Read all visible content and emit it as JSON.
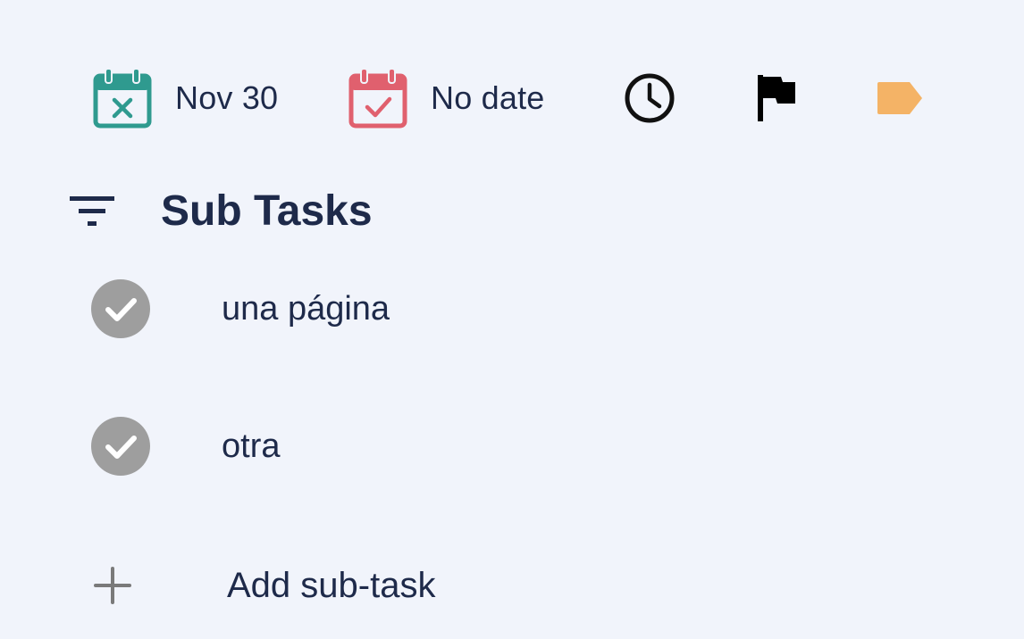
{
  "toolbar": {
    "start_date_label": "Nov 30",
    "due_date_label": "No date",
    "colors": {
      "start_calendar": "#2f9a8f",
      "due_calendar": "#e0606e",
      "clock": "#111111",
      "flag": "#000000",
      "tag": "#f4b366"
    },
    "icons": [
      "calendar-x-icon",
      "calendar-check-icon",
      "clock-icon",
      "flag-icon",
      "tag-icon"
    ]
  },
  "subtasks_section": {
    "title": "Sub Tasks",
    "filter_icon": "filter-icon",
    "items": [
      {
        "label": "una página",
        "completed": true
      },
      {
        "label": "otra",
        "completed": true
      }
    ],
    "add_label": "Add sub-task",
    "add_icon": "plus-icon",
    "check_color": "#9e9e9e"
  }
}
